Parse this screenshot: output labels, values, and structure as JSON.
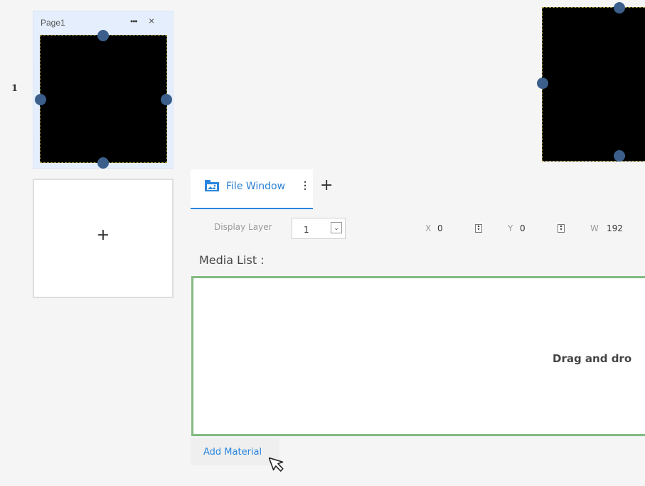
{
  "pages": {
    "items": [
      {
        "index": "1",
        "title": "Page1"
      }
    ],
    "more_icon": "ellipsis-icon",
    "close_icon": "×",
    "add_icon": "+"
  },
  "tabs": {
    "active_label": "File Window",
    "menu_icon": "⋮",
    "add_icon": "+"
  },
  "properties": {
    "display_layer_label": "Display Layer",
    "display_layer_value": "1",
    "x_label": "X",
    "x_value": "0",
    "y_label": "Y",
    "y_value": "0",
    "w_label": "W",
    "w_value": "192"
  },
  "media": {
    "label": "Media List :",
    "drop_text": "Drag and dro",
    "add_material": "Add Material"
  },
  "colors": {
    "accent": "#2b86de",
    "drop_border": "#82bb82",
    "page_card": "#e5eefc",
    "handle": "#3b5f8a"
  }
}
